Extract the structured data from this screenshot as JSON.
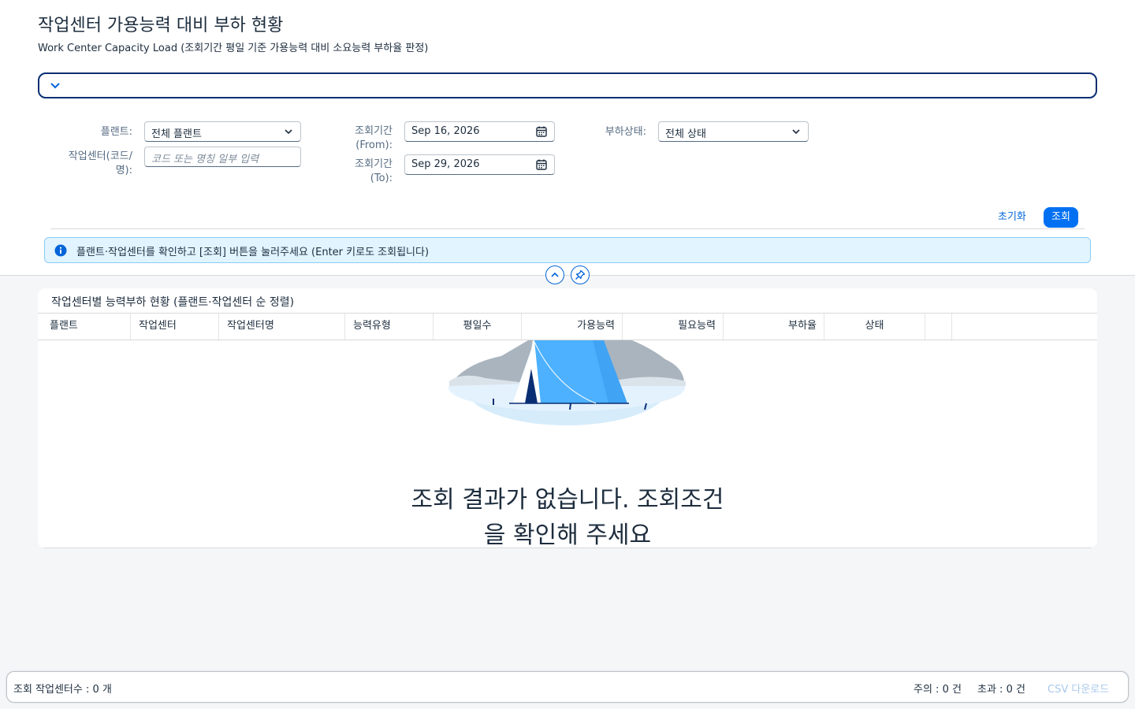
{
  "page": {
    "title": "작업센터 가용능력 대비 부하 현황",
    "subtitle": "Work Center Capacity Load (조회기간 평일 기준 가용능력 대비 소요능력 부하율 판정)"
  },
  "filters": {
    "plant": {
      "label": "플랜트:",
      "value": "전체 플랜트"
    },
    "work_center": {
      "label": "작업센터(코드/명):",
      "placeholder": "코드 또는 명칭 일부 입력",
      "value": ""
    },
    "period_from": {
      "label": "조회기간 (From):",
      "value": "Sep 16, 2026"
    },
    "period_to": {
      "label": "조회기간 (To):",
      "value": "Sep 29, 2026"
    },
    "load_status": {
      "label": "부하상태:",
      "value": "전체 상태"
    },
    "reset_label": "초기화",
    "search_label": "조회"
  },
  "info_message": "플랜트·작업센터를 확인하고 [조회] 버튼을 눌러주세요 (Enter 키로도 조회됩니다)",
  "table": {
    "title": "작업센터별 능력부하 현황 (플랜트·작업센터 순 정렬)",
    "columns": [
      "플랜트",
      "작업센터",
      "작업센터명",
      "능력유형",
      "평일수",
      "가용능력",
      "필요능력",
      "부하율",
      "상태"
    ],
    "no_data_line1": "조회 결과가 없습니다. 조회조건",
    "no_data_line2": "을 확인해 주세요"
  },
  "footer": {
    "count": "조회 작업센터수 : 0 개",
    "warning": "주의 : 0 건",
    "exceeded": "초과 : 0 건",
    "csv_label": "CSV 다운로드"
  },
  "colors": {
    "accent": "#0070f2",
    "link": "#0064d9",
    "info_bg": "#e1f4ff",
    "variant_border": "#0a2e73"
  }
}
